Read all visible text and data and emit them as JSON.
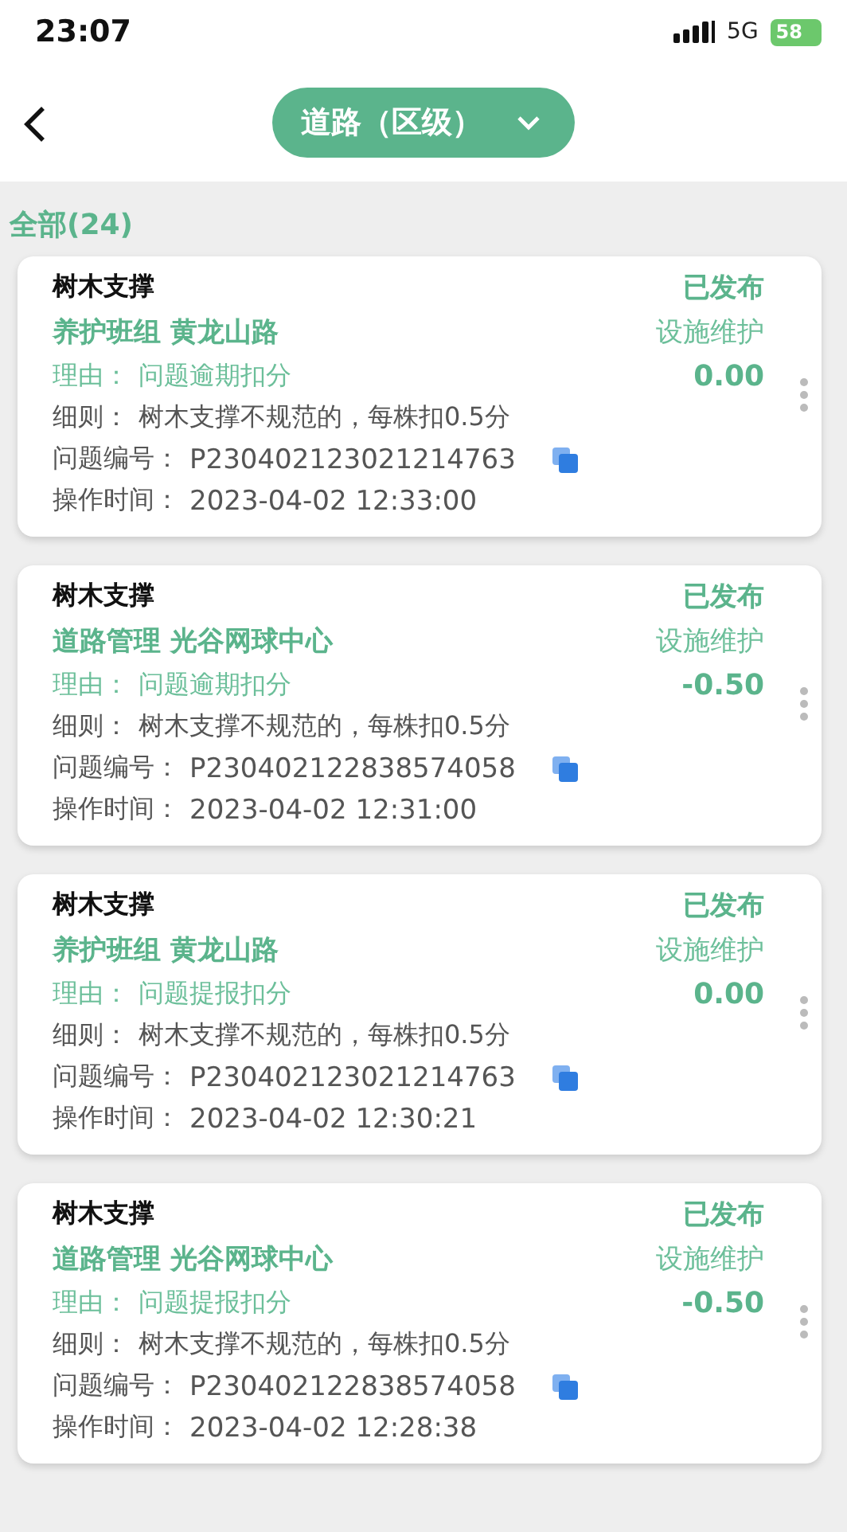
{
  "status_bar": {
    "time": "23:07",
    "network": "5G",
    "battery": "58"
  },
  "header": {
    "selector": "道路（区级）"
  },
  "filter": {
    "label": "全部(24)"
  },
  "records": [
    {
      "title": "树木支撑",
      "status": "已发布",
      "team": "养护班组 黄龙山路",
      "category": "设施维护",
      "reason_label": "理由：",
      "reason": "问题逾期扣分",
      "score": "0.00",
      "rule_label": "细则：",
      "rule": "树木支撑不规范的，每株扣0.5分",
      "id_label": "问题编号：",
      "id": "P230402123021214763",
      "time_label": "操作时间：",
      "time": "2023-04-02 12:33:00"
    },
    {
      "title": "树木支撑",
      "status": "已发布",
      "team": "道路管理 光谷网球中心",
      "category": "设施维护",
      "reason_label": "理由：",
      "reason": "问题逾期扣分",
      "score": "-0.50",
      "rule_label": "细则：",
      "rule": "树木支撑不规范的，每株扣0.5分",
      "id_label": "问题编号：",
      "id": "P230402122838574058",
      "time_label": "操作时间：",
      "time": "2023-04-02 12:31:00"
    },
    {
      "title": "树木支撑",
      "status": "已发布",
      "team": "养护班组 黄龙山路",
      "category": "设施维护",
      "reason_label": "理由：",
      "reason": "问题提报扣分",
      "score": "0.00",
      "rule_label": "细则：",
      "rule": "树木支撑不规范的，每株扣0.5分",
      "id_label": "问题编号：",
      "id": "P230402123021214763",
      "time_label": "操作时间：",
      "time": "2023-04-02 12:30:21"
    },
    {
      "title": "树木支撑",
      "status": "已发布",
      "team": "道路管理 光谷网球中心",
      "category": "设施维护",
      "reason_label": "理由：",
      "reason": "问题提报扣分",
      "score": "-0.50",
      "rule_label": "细则：",
      "rule": "树木支撑不规范的，每株扣0.5分",
      "id_label": "问题编号：",
      "id": "P230402122838574058",
      "time_label": "操作时间：",
      "time": "2023-04-02 12:28:38"
    }
  ]
}
